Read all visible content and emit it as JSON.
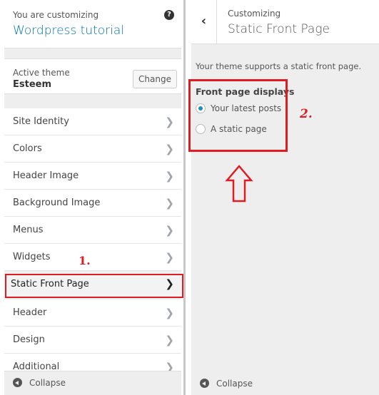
{
  "sidebar": {
    "customizing_label": "You are customizing",
    "site_title": "Wordpress tutorial",
    "help_icon": "question-circle-icon",
    "active_theme_label": "Active theme",
    "active_theme_name": "Esteem",
    "change_label": "Change",
    "items": [
      {
        "label": "Site Identity"
      },
      {
        "label": "Colors"
      },
      {
        "label": "Header Image"
      },
      {
        "label": "Background Image"
      },
      {
        "label": "Menus"
      },
      {
        "label": "Widgets"
      },
      {
        "label": "Static Front Page",
        "active": true
      },
      {
        "label": "Header"
      },
      {
        "label": "Design"
      },
      {
        "label": "Additional"
      }
    ],
    "collapse_label": "Collapse"
  },
  "panel": {
    "breadcrumb": "Customizing",
    "title": "Static Front Page",
    "description": "Your theme supports a static front page.",
    "group_label": "Front page displays",
    "options": [
      {
        "label": "Your latest posts",
        "selected": true
      },
      {
        "label": "A static page",
        "selected": false
      }
    ],
    "collapse_label": "Collapse"
  },
  "annotations": {
    "step1": "1.",
    "step2": "2.",
    "highlight_color": "#e11b22",
    "accent": "#0073aa"
  }
}
